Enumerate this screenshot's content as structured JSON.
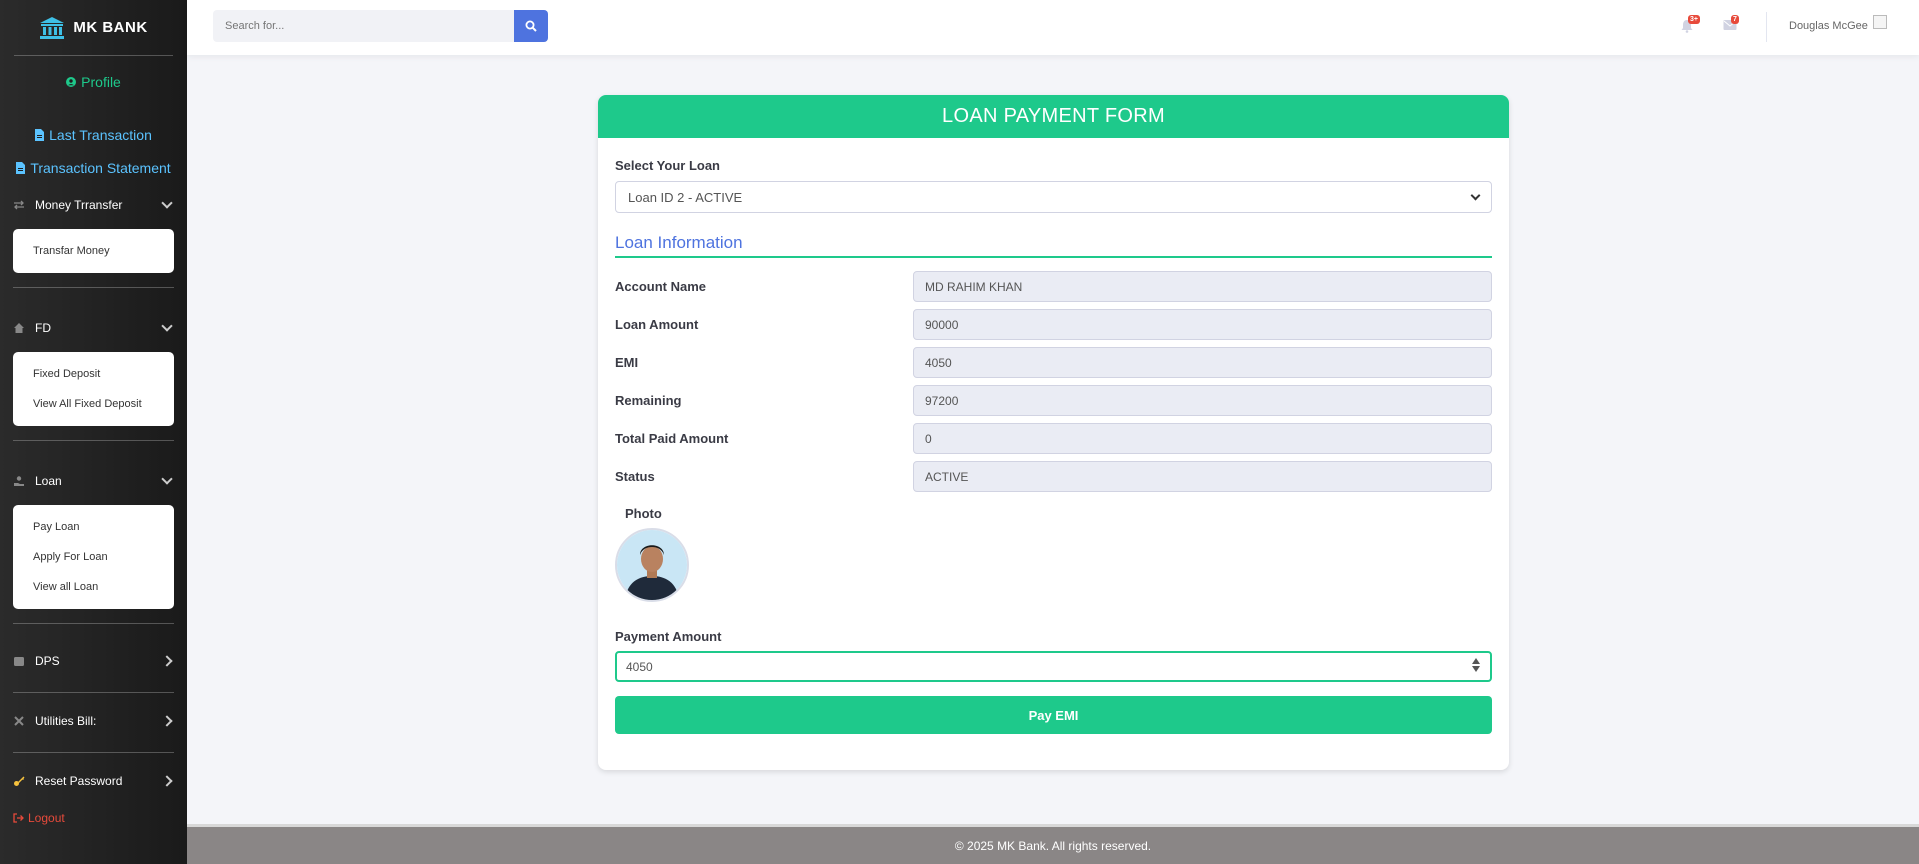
{
  "brand": {
    "name": "MK BANK",
    "icon": "bank-icon"
  },
  "sidebar": {
    "profile": "Profile",
    "last_transaction": "Last Transaction",
    "transaction_statement": "Transaction Statement",
    "money_transfer": {
      "label": "Money Trransfer",
      "items": [
        "Transfar Money"
      ]
    },
    "fd": {
      "label": "FD",
      "items": [
        "Fixed Deposit",
        "View All Fixed Deposit"
      ]
    },
    "loan": {
      "label": "Loan",
      "items": [
        "Pay Loan",
        "Apply For Loan",
        "View all Loan"
      ]
    },
    "dps": "DPS",
    "utilities": "Utilities Bill:",
    "reset_password": "Reset Password",
    "logout": "Logout"
  },
  "topbar": {
    "search_placeholder": "Search for...",
    "alerts_badge": "3+",
    "messages_badge": "7",
    "user_name": "Douglas McGee"
  },
  "form": {
    "title": "LOAN PAYMENT FORM",
    "select_label": "Select Your Loan",
    "selected_loan": "Loan ID 2 - ACTIVE",
    "info_title": "Loan Information",
    "fields": [
      {
        "label": "Account Name",
        "value": "MD RAHIM KHAN"
      },
      {
        "label": "Loan Amount",
        "value": "90000"
      },
      {
        "label": "EMI",
        "value": "4050"
      },
      {
        "label": "Remaining",
        "value": "97200"
      },
      {
        "label": "Total Paid Amount",
        "value": "0"
      },
      {
        "label": "Status",
        "value": "ACTIVE"
      }
    ],
    "photo_label": "Photo",
    "payment_label": "Payment Amount",
    "payment_value": "4050",
    "submit": "Pay EMI"
  },
  "footer": {
    "text": "© 2025 MK Bank. All rights reserved."
  },
  "colors": {
    "accent": "#1ec98b",
    "primary": "#4e73df",
    "danger": "#e74a3b"
  }
}
